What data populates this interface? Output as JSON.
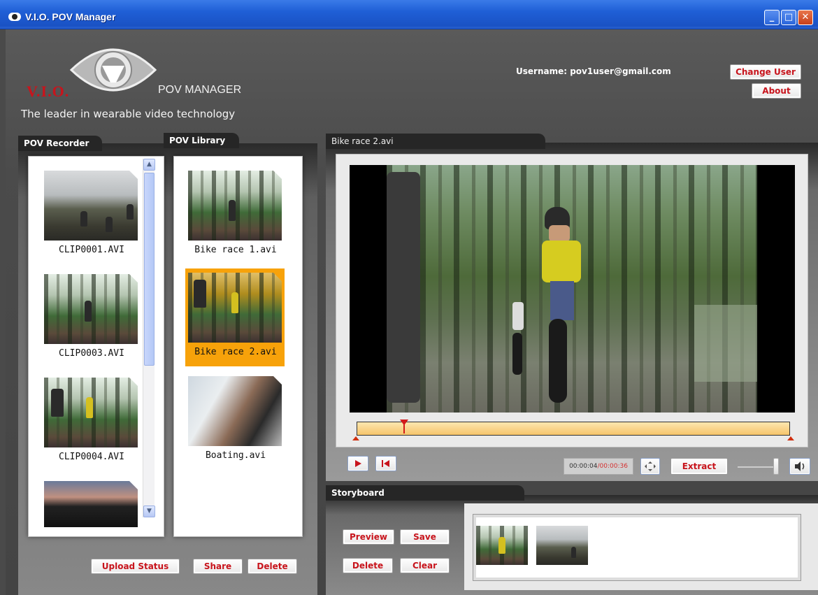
{
  "window": {
    "title": "V.I.O. POV Manager",
    "controls": [
      "minimize",
      "maximize",
      "close"
    ]
  },
  "header": {
    "logo_brand": "V.I.O.",
    "logo_product": "POV MANAGER",
    "tagline": "The leader in wearable video technology",
    "username_label": "Username: pov1user@gmail.com",
    "change_user_label": "Change User",
    "about_label": "About"
  },
  "recorder": {
    "tab_label": "POV Recorder",
    "clips": [
      {
        "label": "CLIP0001.AVI",
        "thumb": "cyclists-on-road"
      },
      {
        "label": "CLIP0003.AVI",
        "thumb": "forest-cyclist"
      },
      {
        "label": "CLIP0004.AVI",
        "thumb": "group-cyclists-forest"
      },
      {
        "label": "",
        "thumb": "road-sunset"
      }
    ]
  },
  "library": {
    "tab_label": "POV Library",
    "items": [
      {
        "label": "Bike race 1.avi",
        "selected": false
      },
      {
        "label": "Bike race 2.avi",
        "selected": true
      },
      {
        "label": "Boating.avi",
        "selected": false
      }
    ],
    "upload_status_label": "Upload Status",
    "share_label": "Share",
    "delete_label": "Delete"
  },
  "player": {
    "tab_label": "Bike race 2.avi",
    "time_current": "00:00:04",
    "time_total": "/00:00:36",
    "playhead_fraction": 0.11,
    "extract_label": "Extract",
    "volume_fraction": 0.95
  },
  "storyboard": {
    "tab_label": "Storyboard",
    "preview_label": "Preview",
    "save_label": "Save",
    "delete_label": "Delete",
    "clear_label": "Clear"
  },
  "colors": {
    "accent_red": "#c8141c",
    "selection_orange": "#f7a20a",
    "timeline_fill": "#f6c46a",
    "titlebar_blue": "#1f5fd6"
  }
}
